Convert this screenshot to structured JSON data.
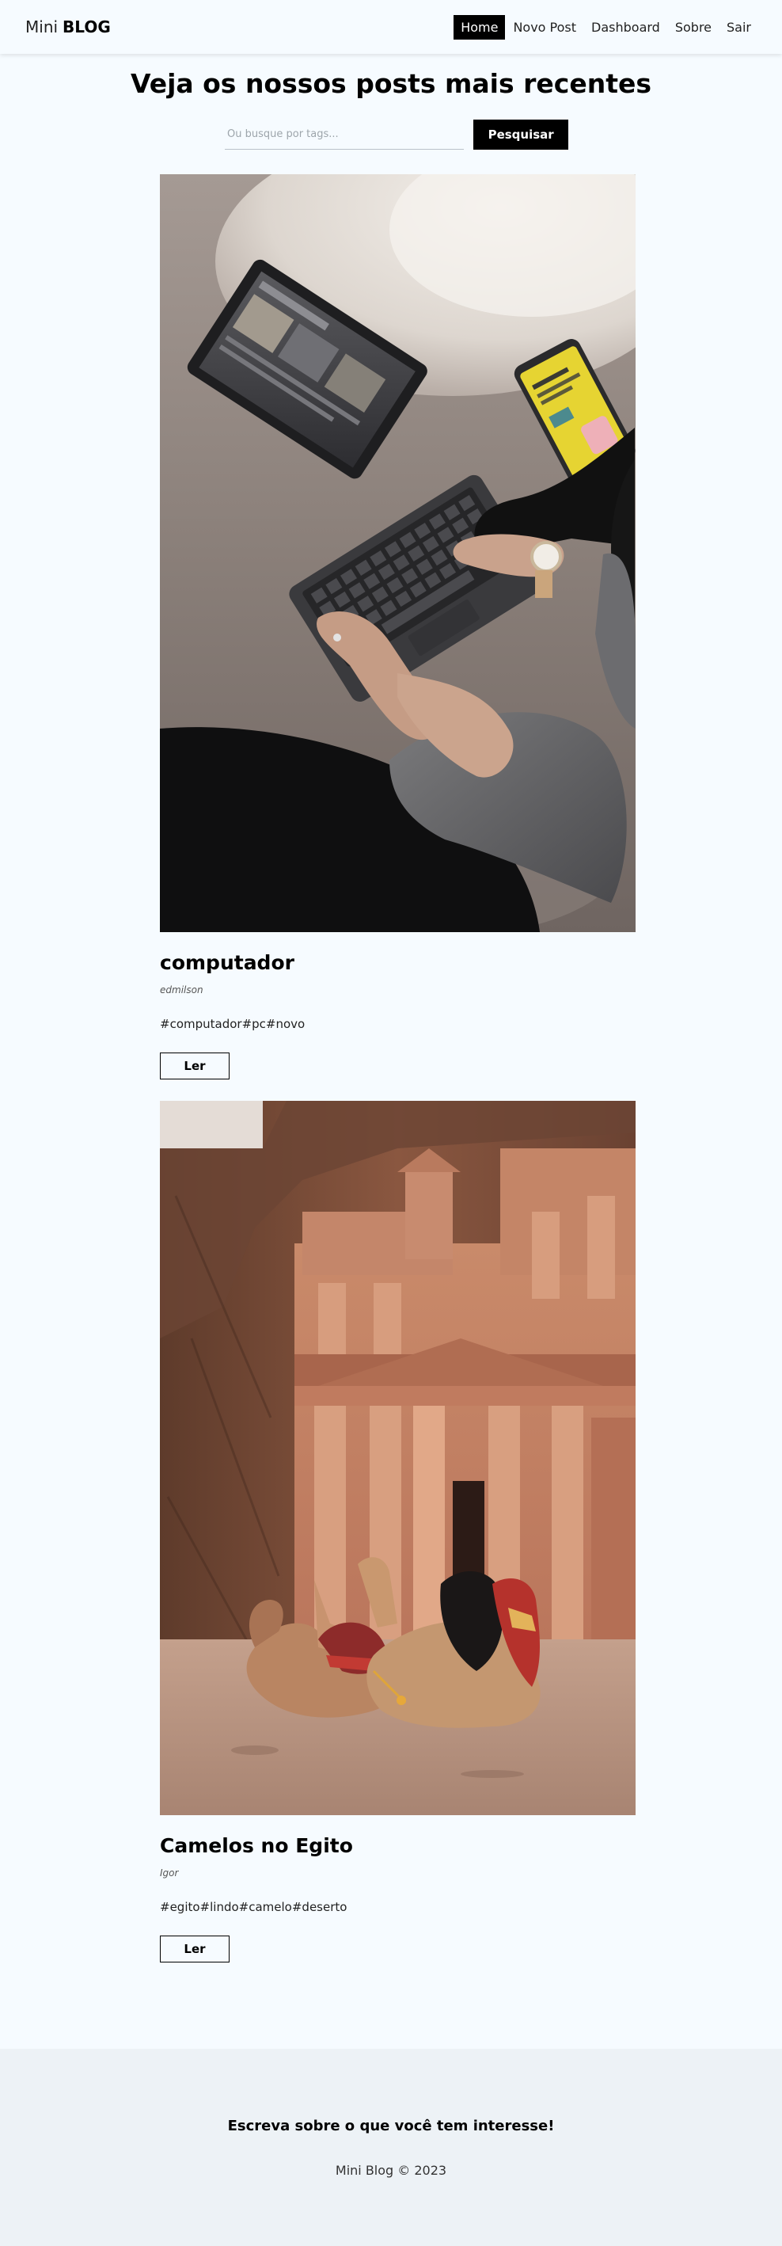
{
  "navbar": {
    "brand_light": "Mini",
    "brand_bold": "BLOG",
    "links": [
      "Home",
      "Novo Post",
      "Dashboard",
      "Sobre",
      "Sair"
    ],
    "active": "Home"
  },
  "main": {
    "title": "Veja os nossos posts mais recentes",
    "search": {
      "placeholder": "Ou busque por tags...",
      "value": "",
      "button_label": "Pesquisar"
    }
  },
  "posts": [
    {
      "title": "computador",
      "author": "edmilson",
      "tags": [
        "#computador",
        "#pc",
        "#novo"
      ],
      "read_label": "Ler",
      "image_alt": "Laptop and smartphone on a fluffy rug"
    },
    {
      "title": "Camelos no Egito",
      "author": "Igor",
      "tags": [
        "#egito",
        "#lindo",
        "#camelo",
        "#deserto"
      ],
      "read_label": "Ler",
      "image_alt": "Camels resting in front of carved stone temple"
    }
  ],
  "footer": {
    "heading": "Escreva sobre o que você tem interesse!",
    "copyright": "Mini Blog © 2023"
  },
  "colors": {
    "background": "#f6fbff",
    "accent": "#000000",
    "footer_bg": "#edf2f6"
  }
}
